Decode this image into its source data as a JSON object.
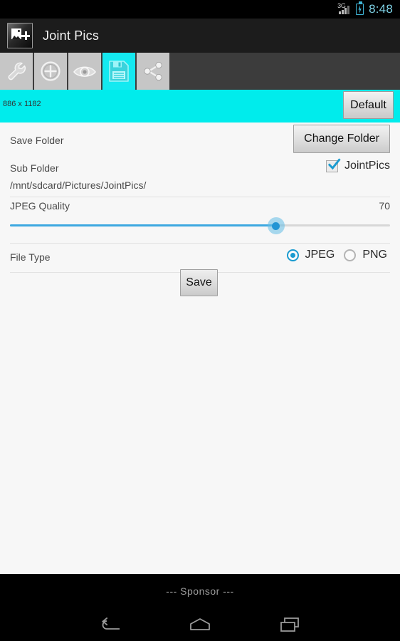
{
  "status_bar": {
    "network_type": "3G",
    "time": "8:48",
    "battery_icon": "battery-charging-icon",
    "signal_icon": "signal-bars-icon"
  },
  "action_bar": {
    "app_icon": "app-logo-icon",
    "title": "Joint Pics"
  },
  "tabs": [
    {
      "name": "settings",
      "icon": "wrench-icon",
      "active": false
    },
    {
      "name": "add",
      "icon": "plus-circle-icon",
      "active": false
    },
    {
      "name": "preview",
      "icon": "eye-icon",
      "active": false
    },
    {
      "name": "save",
      "icon": "floppy-disk-icon",
      "active": true
    },
    {
      "name": "share",
      "icon": "share-icon",
      "active": false
    }
  ],
  "info_bar": {
    "canvas_size": "886 x 1182",
    "default_button": "Default"
  },
  "settings": {
    "save_folder_label": "Save Folder",
    "change_folder_button": "Change Folder",
    "sub_folder_label": "Sub Folder",
    "sub_folder_checkbox_label": "JointPics",
    "sub_folder_checked": true,
    "folder_path": "/mnt/sdcard/Pictures/JointPics/",
    "jpeg_quality_label": "JPEG Quality",
    "jpeg_quality_value": "70",
    "jpeg_quality_percent": 70,
    "file_type_label": "File Type",
    "file_type_options": [
      {
        "label": "JPEG",
        "selected": true
      },
      {
        "label": "PNG",
        "selected": false
      }
    ],
    "save_button": "Save"
  },
  "footer": {
    "sponsor_text": "--- Sponsor ---",
    "nav_back": "back-icon",
    "nav_home": "home-icon",
    "nav_recents": "recents-icon"
  },
  "colors": {
    "accent_cyan": "#00ecec",
    "accent_blue": "#1a9bd0",
    "slider_blue": "#3da8e0",
    "toolbar_dark": "#3c3c3c",
    "action_bar": "#1c1c1c",
    "content_bg": "#f7f7f7",
    "time_blue": "#7fd4e8"
  }
}
